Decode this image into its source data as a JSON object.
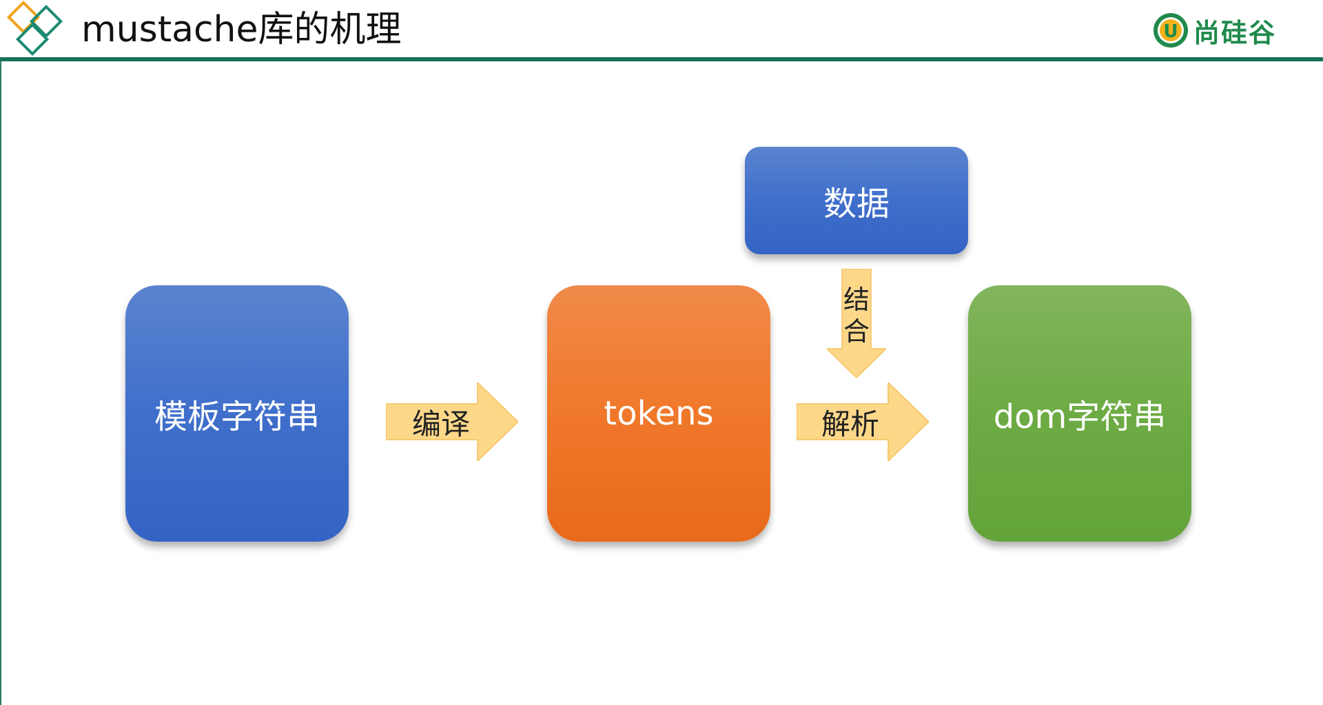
{
  "header": {
    "title": "mustache库的机理",
    "brand_text": "尚硅谷",
    "brand_mark_letter": "U"
  },
  "diagram": {
    "nodes": {
      "template": "模板字符串",
      "tokens": "tokens",
      "dom": "dom字符串",
      "data": "数据"
    },
    "edges": {
      "compile": "编译",
      "parse": "解析",
      "combine": "结合"
    }
  },
  "colors": {
    "header_line": "#16705a",
    "blue": "#4270cb",
    "orange": "#f0782a",
    "green": "#6dab44",
    "arrow_fill": "#fdd889",
    "brand": "#1f8a4c"
  }
}
